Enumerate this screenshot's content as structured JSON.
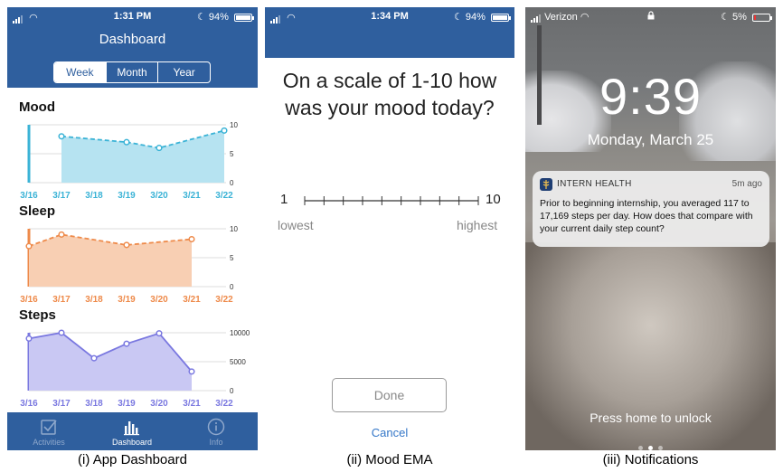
{
  "panel1": {
    "status": {
      "time": "1:31 PM",
      "battery": "94%"
    },
    "title": "Dashboard",
    "segments": [
      "Week",
      "Month",
      "Year"
    ],
    "active_segment": "Week",
    "tabs": [
      {
        "label": "Activities",
        "icon": "checkbox-icon",
        "active": false
      },
      {
        "label": "Dashboard",
        "icon": "bar-chart-icon",
        "active": true
      },
      {
        "label": "Info",
        "icon": "info-icon",
        "active": false
      }
    ],
    "caption": "(i) App Dashboard"
  },
  "panel2": {
    "status": {
      "time": "1:34 PM",
      "battery": "94%"
    },
    "question": "On a scale of 1-10 how was your mood today?",
    "scale_min": "1",
    "scale_max": "10",
    "low_label": "lowest",
    "high_label": "highest",
    "done_label": "Done",
    "cancel_label": "Cancel",
    "caption": "(ii) Mood EMA"
  },
  "panel3": {
    "carrier": "Verizon",
    "battery": "5%",
    "time": "9:39",
    "date": "Monday, March 25",
    "notification": {
      "app": "INTERN HEALTH",
      "ago": "5m ago",
      "body": "Prior to beginning internship, you averaged 117 to 17,169 steps per day. How does that compare with your current daily step count?"
    },
    "unlock_hint": "Press home to unlock",
    "caption": "(iii) Notifications"
  },
  "chart_data": [
    {
      "type": "area",
      "title": "Mood",
      "categories": [
        "3/16",
        "3/17",
        "3/18",
        "3/19",
        "3/20",
        "3/21",
        "3/22"
      ],
      "values": [
        null,
        8,
        null,
        7,
        6,
        null,
        9
      ],
      "yticks": [
        "10",
        "5",
        "0"
      ],
      "ylim": [
        0,
        10
      ],
      "color": "#3bb3d6",
      "fill": "#b6e3f1"
    },
    {
      "type": "area",
      "title": "Sleep",
      "categories": [
        "3/16",
        "3/17",
        "3/18",
        "3/19",
        "3/20",
        "3/21",
        "3/22"
      ],
      "values": [
        7,
        9,
        null,
        7.2,
        null,
        8.2,
        null
      ],
      "yticks": [
        "10",
        "5",
        "0"
      ],
      "ylim": [
        0,
        10
      ],
      "color": "#ee8a4a",
      "fill": "#f8cfb3"
    },
    {
      "type": "area",
      "title": "Steps",
      "categories": [
        "3/16",
        "3/17",
        "3/18",
        "3/19",
        "3/20",
        "3/21",
        "3/22"
      ],
      "values": [
        9000,
        10000,
        5600,
        8100,
        9900,
        3300,
        null
      ],
      "yticks": [
        "10000",
        "5000",
        "0"
      ],
      "ylim": [
        0,
        10000
      ],
      "color": "#7a78e0",
      "fill": "#c9c8f3"
    }
  ]
}
